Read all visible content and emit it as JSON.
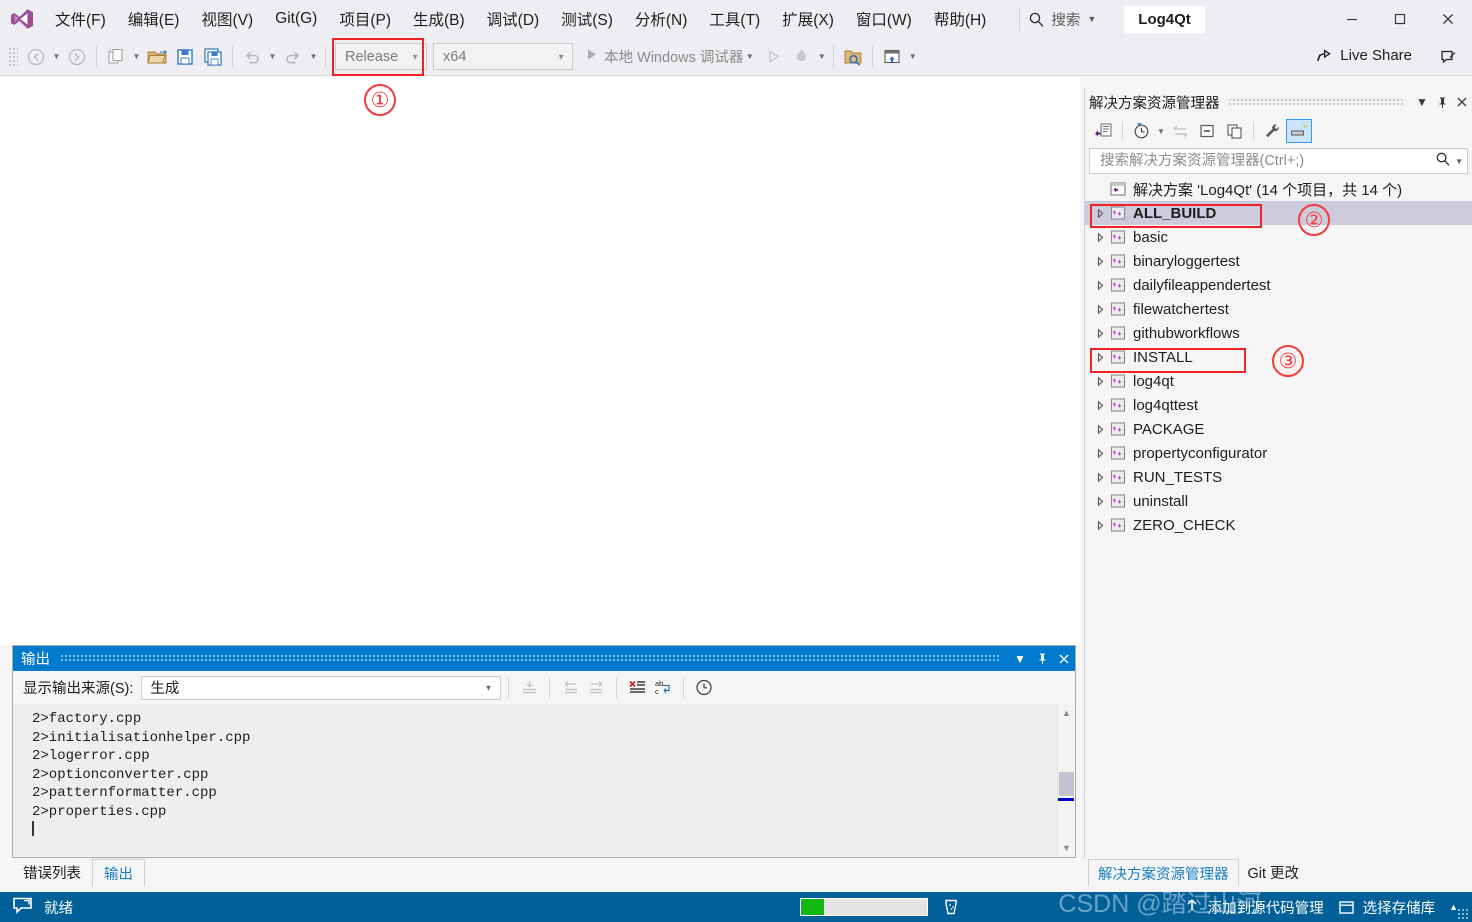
{
  "window": {
    "project_title": "Log4Qt",
    "minimize_icon": "minimize-icon",
    "maximize_icon": "maximize-icon",
    "close_icon": "close-icon"
  },
  "menu": {
    "logo_icon": "visual-studio-logo-icon",
    "items": [
      {
        "label": "文件(F)"
      },
      {
        "label": "编辑(E)"
      },
      {
        "label": "视图(V)"
      },
      {
        "label": "Git(G)"
      },
      {
        "label": "项目(P)"
      },
      {
        "label": "生成(B)"
      },
      {
        "label": "调试(D)"
      },
      {
        "label": "测试(S)"
      },
      {
        "label": "分析(N)"
      },
      {
        "label": "工具(T)"
      },
      {
        "label": "扩展(X)"
      },
      {
        "label": "窗口(W)"
      },
      {
        "label": "帮助(H)"
      }
    ],
    "search": {
      "label": "搜索",
      "icon": "search-icon"
    }
  },
  "toolbar": {
    "nav_back_icon": "navigate-back-icon",
    "nav_forward_icon": "navigate-forward-icon",
    "new_item_icon": "new-item-icon",
    "open_file_icon": "open-file-icon",
    "save_icon": "save-icon",
    "save_all_icon": "save-all-icon",
    "undo_icon": "undo-icon",
    "redo_icon": "redo-icon",
    "configuration": "Release",
    "platform": "x64",
    "run_label": "本地 Windows 调试器",
    "run_icon": "play-icon",
    "start_no_debug_icon": "play-outline-icon",
    "hot_reload_icon": "hot-reload-icon",
    "folder_search_icon": "folder-search-icon",
    "window_layout_icon": "window-layout-icon",
    "overflow_icon": "toolbar-overflow-icon",
    "live_share_label": "Live Share",
    "live_share_icon": "live-share-icon",
    "feedback_icon": "send-feedback-icon"
  },
  "solution_explorer": {
    "title": "解决方案资源管理器",
    "title_dropdown_icon": "chevron-down-icon",
    "pin_icon": "pin-icon",
    "close_icon": "close-icon",
    "toolbar": {
      "code_view_icon": "code-view-icon",
      "pending_changes_icon": "pending-changes-icon",
      "sync_icon": "sync-with-active-document-icon",
      "collapse_all_icon": "collapse-all-icon",
      "show_all_files_icon": "show-all-files-icon",
      "properties_icon": "properties-wrench-icon",
      "preview_icon": "preview-selected-items-icon"
    },
    "search_placeholder": "搜索解决方案资源管理器(Ctrl+;)",
    "search_value": "",
    "search_icon": "search-icon",
    "solution_node": {
      "label": "解决方案 'Log4Qt' (14 个项目，共 14 个)",
      "icon": "solution-icon"
    },
    "projects": [
      {
        "label": "ALL_BUILD",
        "selected": true,
        "bold": true,
        "highlight": true
      },
      {
        "label": "basic",
        "selected": false,
        "bold": false,
        "highlight": false
      },
      {
        "label": "binaryloggertest",
        "selected": false,
        "bold": false,
        "highlight": false
      },
      {
        "label": "dailyfileappendertest",
        "selected": false,
        "bold": false,
        "highlight": false
      },
      {
        "label": "filewatchertest",
        "selected": false,
        "bold": false,
        "highlight": false
      },
      {
        "label": "githubworkflows",
        "selected": false,
        "bold": false,
        "highlight": false
      },
      {
        "label": "INSTALL",
        "selected": false,
        "bold": false,
        "highlight": true
      },
      {
        "label": "log4qt",
        "selected": false,
        "bold": false,
        "highlight": false
      },
      {
        "label": "log4qttest",
        "selected": false,
        "bold": false,
        "highlight": false
      },
      {
        "label": "PACKAGE",
        "selected": false,
        "bold": false,
        "highlight": false
      },
      {
        "label": "propertyconfigurator",
        "selected": false,
        "bold": false,
        "highlight": false
      },
      {
        "label": "RUN_TESTS",
        "selected": false,
        "bold": false,
        "highlight": false
      },
      {
        "label": "uninstall",
        "selected": false,
        "bold": false,
        "highlight": false
      },
      {
        "label": "ZERO_CHECK",
        "selected": false,
        "bold": false,
        "highlight": false
      }
    ],
    "tabs": [
      {
        "label": "解决方案资源管理器",
        "active": true
      },
      {
        "label": "Git 更改",
        "active": false
      }
    ]
  },
  "annotations": [
    {
      "number": "①",
      "target": "configuration-combo"
    },
    {
      "number": "②",
      "target": "all-build-project"
    },
    {
      "number": "③",
      "target": "install-project"
    }
  ],
  "output_panel": {
    "title": "输出",
    "dropdown_icon": "chevron-down-icon",
    "pin_icon": "pin-icon",
    "close_icon": "close-icon",
    "source_label": "显示输出来源(S):",
    "source_value": "生成",
    "toolbar": {
      "go_to_message_icon": "go-to-message-icon",
      "prev_message_icon": "previous-message-icon",
      "next_message_icon": "next-message-icon",
      "clear_all_icon": "clear-all-icon",
      "toggle_wordwrap_icon": "toggle-word-wrap-icon",
      "toggle_timestamps_icon": "toggle-timestamps-icon"
    },
    "lines": [
      "2>factory.cpp",
      "2>initialisationhelper.cpp",
      "2>logerror.cpp",
      "2>optionconverter.cpp",
      "2>patternformatter.cpp",
      "2>properties.cpp"
    ],
    "scrollbar": {
      "up_icon": "scroll-up-icon",
      "down_icon": "scroll-down-icon"
    }
  },
  "bottom_tabs": [
    {
      "label": "错误列表",
      "active": false
    },
    {
      "label": "输出",
      "active": true
    }
  ],
  "status_bar": {
    "ready_icon": "ready-icon",
    "ready_text": "就绪",
    "progress_percent": 18,
    "progress_color": "#12b712",
    "test_icon": "test-beaker-icon",
    "source_control_icon": "arrow-up-icon",
    "source_control_text": "添加到源代码管理",
    "select_repo_text": "选择存储库",
    "repo_icon": "repository-icon",
    "caret_icon": "chevron-up-icon"
  },
  "watermark": "CSDN @踏过山河",
  "colors": {
    "accent_blue": "#007acc",
    "status_bar": "#006097",
    "chrome": "#eeeef2",
    "panel_bg": "#f5f5f5",
    "selection": "#cbcbdc",
    "annotation_red": "#ee2222",
    "progress_green": "#12b712"
  }
}
